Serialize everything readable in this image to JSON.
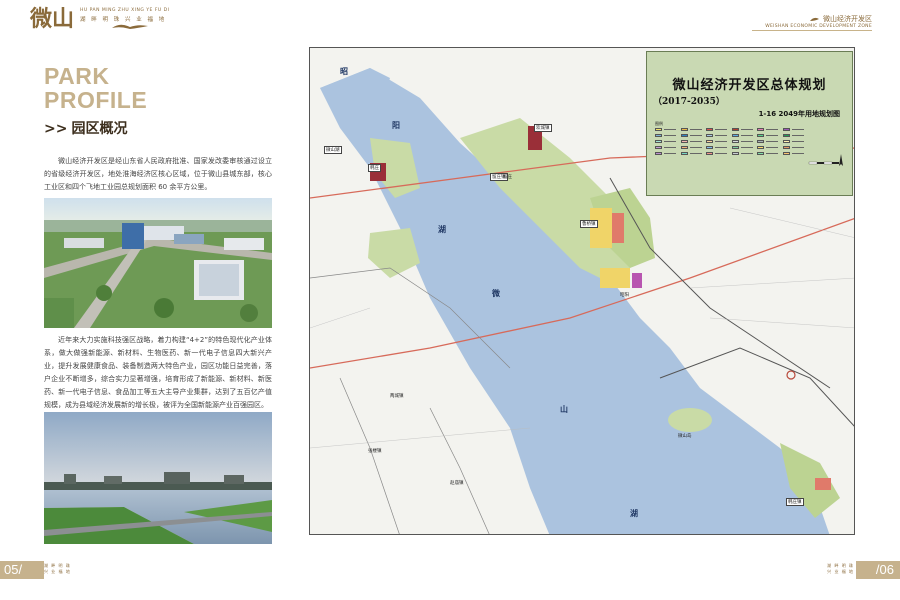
{
  "header": {
    "logo_glyph": "微山",
    "logo_pinyin": "HU PAN MING ZHU  XING YE FU DI",
    "logo_slogan": "湖 畔 明 珠   兴 业 福 地",
    "right_cn": "微山经济开发区",
    "right_en": "WEISHAN ECONOMIC DEVELOPMENT ZONE"
  },
  "left": {
    "park_line1": "PARK",
    "park_line2": "PROFILE",
    "section_arrows": ">>",
    "section_title": "园区概况",
    "para1": "微山经济开发区是经山东省人民政府批准、国家发改委审核通过设立的省级经济开发区，地处淮海经济区核心区域，位于微山县城东部，核心工业区和四个飞地工业园总规划面积 60 余平方公里。",
    "para2": "近年来大力实施科技强区战略，着力构建“4+2”的特色现代化产业体系，做大做强新能源、新材料、生物医药、新一代电子信息四大新兴产业，提升发展健康食品、装备制造两大特色产业，园区功能日益完善，落户企业不断增多，综合实力显著增强，培育形成了新能源、新材料、新医药、新一代电子信息、食品加工等五大主导产业集群，达到了五百亿产值规模，成为县域经济发展新的增长极，被评为全国新能源产业百强园区。"
  },
  "map": {
    "title": "微山经济开发区总体规划",
    "period": "（2017-2035）",
    "subtitle": "1-16  2049年用地规划图",
    "legend_label": "图例",
    "legend_colors": [
      "#f3e36a",
      "#e8b84a",
      "#d9534f",
      "#b0402f",
      "#e07bb0",
      "#9b59b6",
      "#7fb3d5",
      "#2e86c1",
      "#a9cce3",
      "#5dade2",
      "#58d68d",
      "#239b56",
      "#a3e4d7",
      "#f5b7b1",
      "#fad7a0",
      "#d5dbdb",
      "#aab7b8",
      "#fff3b0",
      "#c39bd3",
      "#f0b27a",
      "#85c1e9",
      "#7dcea0",
      "#f7dc6f",
      "#e59866",
      "#bb8fce",
      "#76d7c4",
      "#f1948a",
      "#cacfd2",
      "#82e0aa",
      "#f8c471"
    ],
    "labels": [
      {
        "text": "微山湖",
        "cls": "box"
      },
      {
        "text": "欢城镇",
        "cls": "box"
      },
      {
        "text": "韩庄",
        "cls": "box"
      },
      {
        "text": "留庄镇",
        "cls": "box"
      },
      {
        "text": "鲁桥镇",
        "cls": "box"
      },
      {
        "text": "留庄",
        "cls": ""
      },
      {
        "text": "昭阳",
        "cls": ""
      },
      {
        "text": "微山岛",
        "cls": ""
      },
      {
        "text": "张楼镇",
        "cls": ""
      },
      {
        "text": "两城镇",
        "cls": ""
      },
      {
        "text": "赵庙镇",
        "cls": ""
      },
      {
        "text": "韩庄镇",
        "cls": "box"
      }
    ],
    "lake_chars": [
      "昭",
      "阳",
      "湖",
      "微",
      "山",
      "湖"
    ]
  },
  "footer": {
    "page_left": "05/",
    "page_right": "/06",
    "tag_left": "湖 畔 明 珠\n兴 业 福 地",
    "tag_right": "湖 畔 明 珠\n兴 业 福 地"
  }
}
